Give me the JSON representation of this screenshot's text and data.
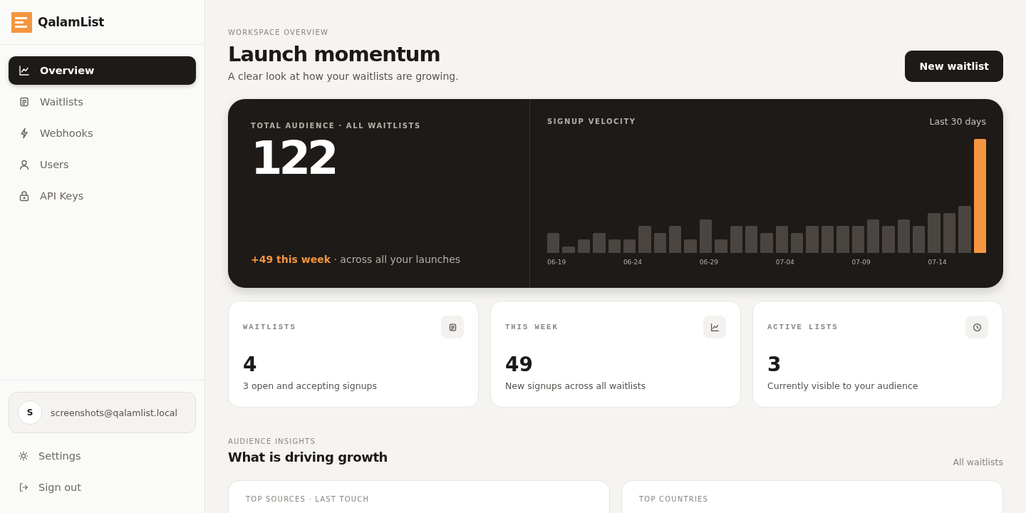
{
  "brand": {
    "name": "QalamList"
  },
  "nav": [
    {
      "label": "Overview",
      "selected": true
    },
    {
      "label": "Waitlists",
      "selected": false
    },
    {
      "label": "Webhooks",
      "selected": false
    },
    {
      "label": "Users",
      "selected": false
    },
    {
      "label": "API Keys",
      "selected": false
    }
  ],
  "account": {
    "avatar_initial": "S",
    "email": "screenshots@qalamlist.local"
  },
  "footer_nav": [
    {
      "label": "Settings"
    },
    {
      "label": "Sign out"
    }
  ],
  "header": {
    "eyebrow": "WORKSPACE OVERVIEW",
    "title": "Launch momentum",
    "subtitle": "A clear look at how your waitlists are growing.",
    "button": "New waitlist"
  },
  "hero": {
    "label": "TOTAL AUDIENCE · ALL WAITLISTS",
    "total": "122",
    "note": "**+49 this week** · across all your launches"
  },
  "velocity": {
    "title": "SIGNUP VELOCITY",
    "range": "Last 30 days",
    "x_labels": [
      "06-19",
      "06-24",
      "06-29",
      "07-04",
      "07-09",
      "07-14"
    ]
  },
  "stats": [
    {
      "label": "WAITLISTS",
      "value": "4",
      "note": "3 open and accepting signups"
    },
    {
      "label": "THIS WEEK",
      "value": "49",
      "note": "New signups across all waitlists"
    },
    {
      "label": "ACTIVE LISTS",
      "value": "3",
      "note": "Currently visible to your audience"
    }
  ],
  "insights": {
    "eyebrow": "AUDIENCE INSIGHTS",
    "title": "What is driving growth",
    "filter": "All waitlists",
    "panels": [
      {
        "title": "TOP SOURCES · LAST TOUCH"
      },
      {
        "title": "TOP COUNTRIES"
      }
    ]
  }
}
